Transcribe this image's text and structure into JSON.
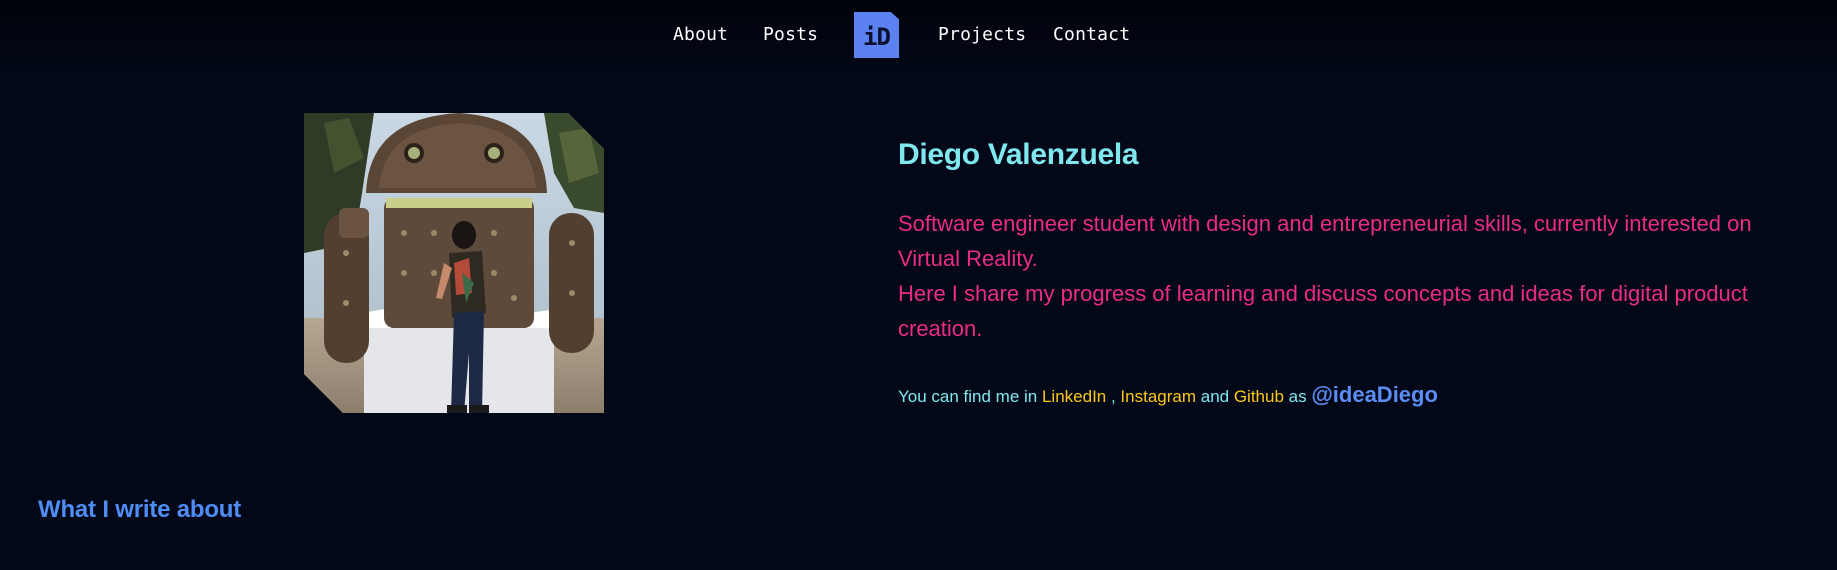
{
  "nav": {
    "about": "About",
    "posts": "Posts",
    "logo": "iD",
    "projects": "Projects",
    "contact": "Contact"
  },
  "profile": {
    "name": "Diego Valenzuela",
    "bio_line1": "Software engineer student with design and entrepreneurial skills, currently interested on Virtual Reality.",
    "bio_line2": "Here I share my progress of learning and discuss concepts and ideas for digital product creation.",
    "find_prefix": "You can find me in ",
    "link_linkedin": "LinkedIn",
    "sep_comma": " , ",
    "link_instagram": "Instagram",
    "sep_and": " and ",
    "link_github": "Github",
    "sep_as": " as ",
    "handle": "@ideaDiego"
  },
  "sections": {
    "what_i_write": "What I write about"
  },
  "colors": {
    "background": "#020817",
    "name": "#7ee8ee",
    "bio": "#ec2b86",
    "link": "#ffc61a",
    "handle": "#5b8df5",
    "logo_bg": "#5b82f0"
  },
  "icons": {
    "logo": "id-logo"
  }
}
